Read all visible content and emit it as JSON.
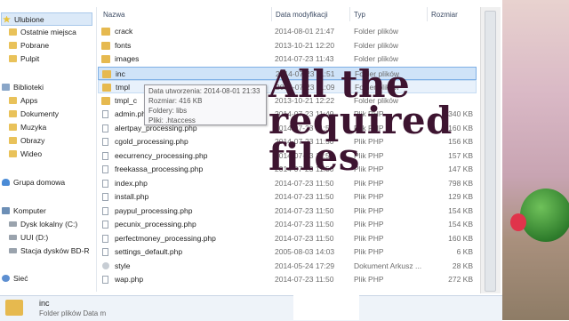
{
  "nav": {
    "items": [
      {
        "label": "Ulubione",
        "icon": "star-icon",
        "group": true,
        "selected": true
      },
      {
        "label": "Ostatnie miejsca",
        "icon": "recent-places-icon"
      },
      {
        "label": "Pobrane",
        "icon": "downloads-icon"
      },
      {
        "label": "Pulpit",
        "icon": "desktop-icon"
      },
      {
        "label": "Biblioteki",
        "icon": "libraries-icon",
        "group": true
      },
      {
        "label": "Apps",
        "icon": "library-folder-icon"
      },
      {
        "label": "Dokumenty",
        "icon": "documents-icon"
      },
      {
        "label": "Muzyka",
        "icon": "music-icon"
      },
      {
        "label": "Obrazy",
        "icon": "pictures-icon"
      },
      {
        "label": "Wideo",
        "icon": "video-icon"
      },
      {
        "label": "Grupa domowa",
        "icon": "homegroup-icon",
        "group": true
      },
      {
        "label": "Komputer",
        "icon": "computer-icon",
        "group": true
      },
      {
        "label": "Dysk lokalny (C:)",
        "icon": "drive-icon"
      },
      {
        "label": "UUI (D:)",
        "icon": "drive-icon"
      },
      {
        "label": "Stacja dysków BD-R",
        "icon": "optical-drive-icon"
      },
      {
        "label": "Sieć",
        "icon": "network-icon",
        "group": true
      }
    ]
  },
  "columns": {
    "name": "Nazwa",
    "date": "Data modyfikacji",
    "type": "Typ",
    "size": "Rozmiar"
  },
  "files": [
    {
      "name": "crack",
      "date": "2014-08-01 21:47",
      "type": "Folder plików",
      "size": "",
      "kind": "folder"
    },
    {
      "name": "fonts",
      "date": "2013-10-21 12:20",
      "type": "Folder plików",
      "size": "",
      "kind": "folder"
    },
    {
      "name": "images",
      "date": "2014-07-23 11:43",
      "type": "Folder plików",
      "size": "",
      "kind": "folder"
    },
    {
      "name": "inc",
      "date": "2014-07-23 11:51",
      "type": "Folder plików",
      "size": "",
      "kind": "folder",
      "state": "selected"
    },
    {
      "name": "tmpl",
      "date": "2014-07-23 11:09",
      "type": "Folder plików",
      "size": "",
      "kind": "folder",
      "state": "hover"
    },
    {
      "name": "tmpl_c",
      "date": "2013-10-21 12:22",
      "type": "Folder plików",
      "size": "",
      "kind": "folder"
    },
    {
      "name": "admin.php",
      "date": "2014-07-23 11:49",
      "type": "Plik PHP",
      "size": "340 KB",
      "kind": "file"
    },
    {
      "name": "alertpay_processing.php",
      "date": "2014-07-23 11:50",
      "type": "Plik PHP",
      "size": "160 KB",
      "kind": "file"
    },
    {
      "name": "cgold_processing.php",
      "date": "2014-07-23 11:50",
      "type": "Plik PHP",
      "size": "156 KB",
      "kind": "file"
    },
    {
      "name": "eecurrency_processing.php",
      "date": "2014-07-23 11:50",
      "type": "Plik PHP",
      "size": "157 KB",
      "kind": "file"
    },
    {
      "name": "freekassa_processing.php",
      "date": "2014-07-23 11:50",
      "type": "Plik PHP",
      "size": "147 KB",
      "kind": "file"
    },
    {
      "name": "index.php",
      "date": "2014-07-23 11:50",
      "type": "Plik PHP",
      "size": "798 KB",
      "kind": "file"
    },
    {
      "name": "install.php",
      "date": "2014-07-23 11:50",
      "type": "Plik PHP",
      "size": "129 KB",
      "kind": "file"
    },
    {
      "name": "paypul_processing.php",
      "date": "2014-07-23 11:50",
      "type": "Plik PHP",
      "size": "154 KB",
      "kind": "file"
    },
    {
      "name": "pecunix_processing.php",
      "date": "2014-07-23 11:50",
      "type": "Plik PHP",
      "size": "154 KB",
      "kind": "file"
    },
    {
      "name": "perfectmoney_processing.php",
      "date": "2014-07-23 11:50",
      "type": "Plik PHP",
      "size": "160 KB",
      "kind": "file"
    },
    {
      "name": "settings_default.php",
      "date": "2005-08-03 14:03",
      "type": "Plik PHP",
      "size": "6 KB",
      "kind": "file"
    },
    {
      "name": "style",
      "date": "2014-05-24 17:29",
      "type": "Dokument Arkusz ...",
      "size": "28 KB",
      "kind": "gear"
    },
    {
      "name": "wap.php",
      "date": "2014-07-23 11:50",
      "type": "Plik PHP",
      "size": "272 KB",
      "kind": "file"
    }
  ],
  "tooltip": {
    "line1": "Data utworzenia: 2014-08-01 21:33",
    "line2": "Rozmiar: 416 KB",
    "line3": "Foldery: libs",
    "line4": "Pliki: .htaccess"
  },
  "overlay": {
    "line1": "All the",
    "line2": "required",
    "line3": "files"
  },
  "details": {
    "name": "inc",
    "meta": "Folder plików   Data m"
  },
  "colors": {
    "selection": "#cfe3f8",
    "overlay_text": "#3d1430",
    "folder": "#e6b94f"
  }
}
